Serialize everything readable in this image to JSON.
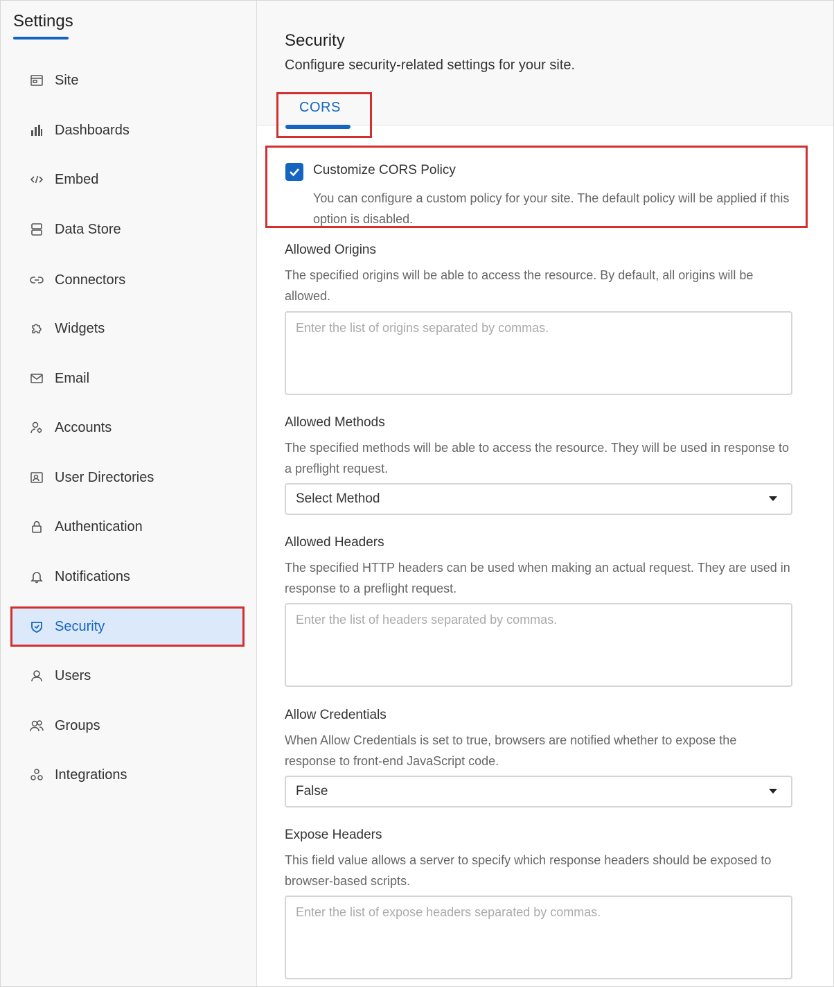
{
  "sidebar": {
    "title": "Settings",
    "items": [
      {
        "label": "Site",
        "icon": "site-icon"
      },
      {
        "label": "Dashboards",
        "icon": "dashboards-icon"
      },
      {
        "label": "Embed",
        "icon": "code-icon"
      },
      {
        "label": "Data Store",
        "icon": "database-icon"
      },
      {
        "label": "Connectors",
        "icon": "link-icon"
      },
      {
        "label": "Widgets",
        "icon": "puzzle-icon"
      },
      {
        "label": "Email",
        "icon": "mail-icon"
      },
      {
        "label": "Accounts",
        "icon": "accounts-icon"
      },
      {
        "label": "User Directories",
        "icon": "contact-card-icon"
      },
      {
        "label": "Authentication",
        "icon": "lock-icon"
      },
      {
        "label": "Notifications",
        "icon": "bell-icon"
      },
      {
        "label": "Security",
        "icon": "shield-icon"
      },
      {
        "label": "Users",
        "icon": "user-icon"
      },
      {
        "label": "Groups",
        "icon": "group-icon"
      },
      {
        "label": "Integrations",
        "icon": "integrations-icon"
      }
    ],
    "active_item": "Security"
  },
  "page": {
    "title": "Security",
    "subtitle": "Configure security-related settings for your site."
  },
  "tabs": [
    {
      "label": "CORS",
      "active": true
    }
  ],
  "cors": {
    "checkbox_label": "Customize CORS Policy",
    "checked": true,
    "description": "You can configure a custom policy for your site. The default policy will be applied if this option is disabled."
  },
  "fields": {
    "allowed_origins": {
      "label": "Allowed Origins",
      "description": "The specified origins will be able to access the resource. By default, all origins will be allowed.",
      "placeholder": "Enter the list of origins separated by commas."
    },
    "allowed_methods": {
      "label": "Allowed Methods",
      "description": "The specified methods will be able to access the resource. They will be used in response to a preflight request.",
      "value": "Select Method"
    },
    "allowed_headers": {
      "label": "Allowed Headers",
      "description": "The specified HTTP headers can be used when making an actual request. They are used in response to a preflight request.",
      "placeholder": "Enter the list of headers separated by commas."
    },
    "allow_credentials": {
      "label": "Allow Credentials",
      "description": "When Allow Credentials is set to true, browsers are notified whether to expose the response to front-end JavaScript code.",
      "value": "False"
    },
    "expose_headers": {
      "label": "Expose Headers",
      "description": "This field value allows a server to specify which response headers should be exposed to browser-based scripts.",
      "placeholder": "Enter the list of expose headers separated by commas."
    }
  },
  "colors": {
    "accent": "#1565c0",
    "highlight_border": "#d32f2f",
    "active_bg": "#dce9fb"
  }
}
